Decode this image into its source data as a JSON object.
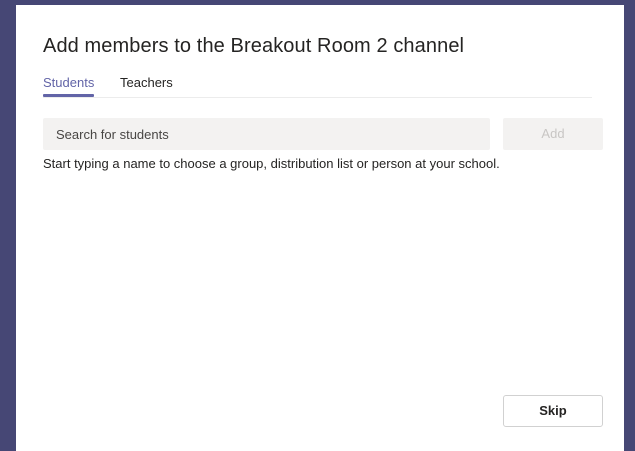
{
  "dialog": {
    "title": "Add members to the Breakout Room 2 channel",
    "tabs": [
      {
        "label": "Students",
        "active": true
      },
      {
        "label": "Teachers",
        "active": false
      }
    ],
    "search": {
      "placeholder": "Search for students",
      "value": ""
    },
    "add_label": "Add",
    "helper_text": "Start typing a name to choose a group, distribution list or person at your school.",
    "skip_label": "Skip"
  },
  "colors": {
    "backdrop": "#464775",
    "accent": "#6264a7",
    "input_bg": "#f3f2f1",
    "disabled_text": "#c8c6c4"
  }
}
